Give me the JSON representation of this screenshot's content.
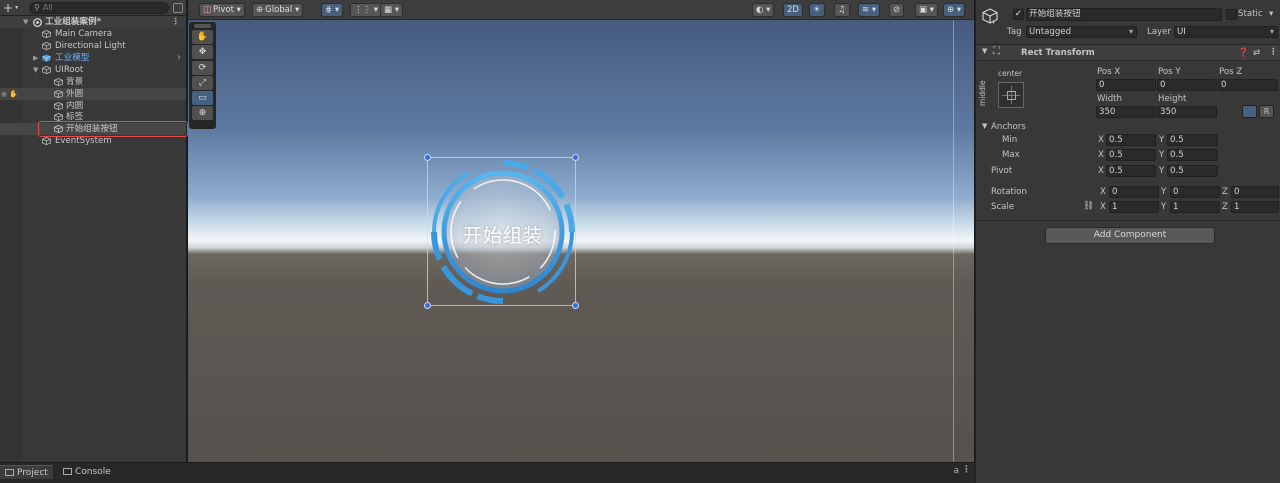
{
  "hierarchy": {
    "search_placeholder": "All",
    "scene_name": "工业组装案例*",
    "items": [
      {
        "label": "Main Camera"
      },
      {
        "label": "Directional Light"
      },
      {
        "label": "工业模型"
      },
      {
        "label": "UIRoot"
      },
      {
        "label": "背景"
      },
      {
        "label": "外圆"
      },
      {
        "label": "内圆"
      },
      {
        "label": "标签"
      },
      {
        "label": "开始组装按钮"
      },
      {
        "label": "EventSystem"
      }
    ]
  },
  "scene_toolbar": {
    "pivot": "Pivot",
    "global": "Global",
    "mode_2d": "2D"
  },
  "scene": {
    "button_text": "开始组装",
    "tools": [
      "✋",
      "✥",
      "⟳",
      "⤢",
      "▭",
      "⊕"
    ]
  },
  "inspector": {
    "object_name": "开始组装按钮",
    "static_label": "Static",
    "tag_label": "Tag",
    "tag_value": "Untagged",
    "layer_label": "Layer",
    "layer_value": "UI",
    "component_title": "Rect Transform",
    "anchor_h": "center",
    "anchor_v": "middle",
    "pos_x_label": "Pos X",
    "pos_y_label": "Pos Y",
    "pos_z_label": "Pos Z",
    "pos_x": "0",
    "pos_y": "0",
    "pos_z": "0",
    "width_label": "Width",
    "height_label": "Height",
    "width": "350",
    "height": "350",
    "r_button": "R",
    "anchors_label": "Anchors",
    "min_label": "Min",
    "max_label": "Max",
    "pivot_label": "Pivot",
    "min_x": "0.5",
    "min_y": "0.5",
    "max_x": "0.5",
    "max_y": "0.5",
    "pivot_x": "0.5",
    "pivot_y": "0.5",
    "rotation_label": "Rotation",
    "scale_label": "Scale",
    "rot_x": "0",
    "rot_y": "0",
    "rot_z": "0",
    "scale_x": "1",
    "scale_y": "1",
    "scale_z": "1",
    "axis_x": "X",
    "axis_y": "Y",
    "axis_z": "Z",
    "add_component": "Add Component"
  },
  "bottom_tabs": {
    "project": "Project",
    "console": "Console"
  },
  "colors": {
    "accent": "#46607f",
    "selection_outline": "#e14b4b",
    "prefab_text": "#6fb2f2",
    "ring_blue": "#3f9be0"
  }
}
